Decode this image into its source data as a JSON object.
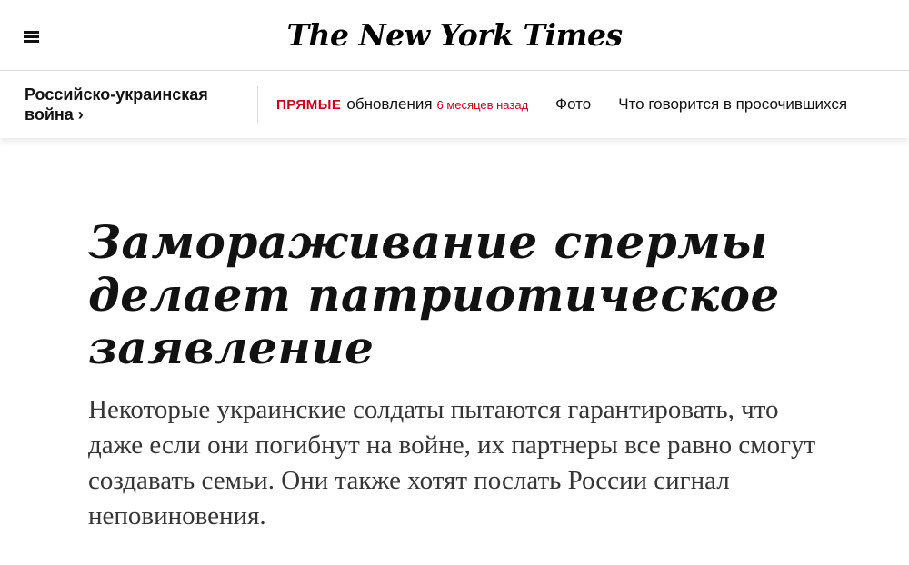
{
  "masthead": {
    "logo": "The New York Times",
    "menu_icon": "hamburger-menu-icon"
  },
  "subnav": {
    "section": "Российско-украинская война ›",
    "live": {
      "label": "ПРЯМЫЕ",
      "text": "обновления",
      "time": "6 месяцев назад"
    },
    "links": [
      "Фото",
      "Что говорится в просочившихся"
    ]
  },
  "article": {
    "headline": "Замораживание спермы делает патриотическое заявление",
    "summary": "Некоторые украинские солдаты пытаются гарантировать, что даже если они погибнут на войне, их партнеры все равно смогут создавать семьи. Они также хотят послать России сигнал неповиновения."
  },
  "colors": {
    "accent_red": "#d0021b",
    "text": "#121212",
    "summary_text": "#363636"
  }
}
